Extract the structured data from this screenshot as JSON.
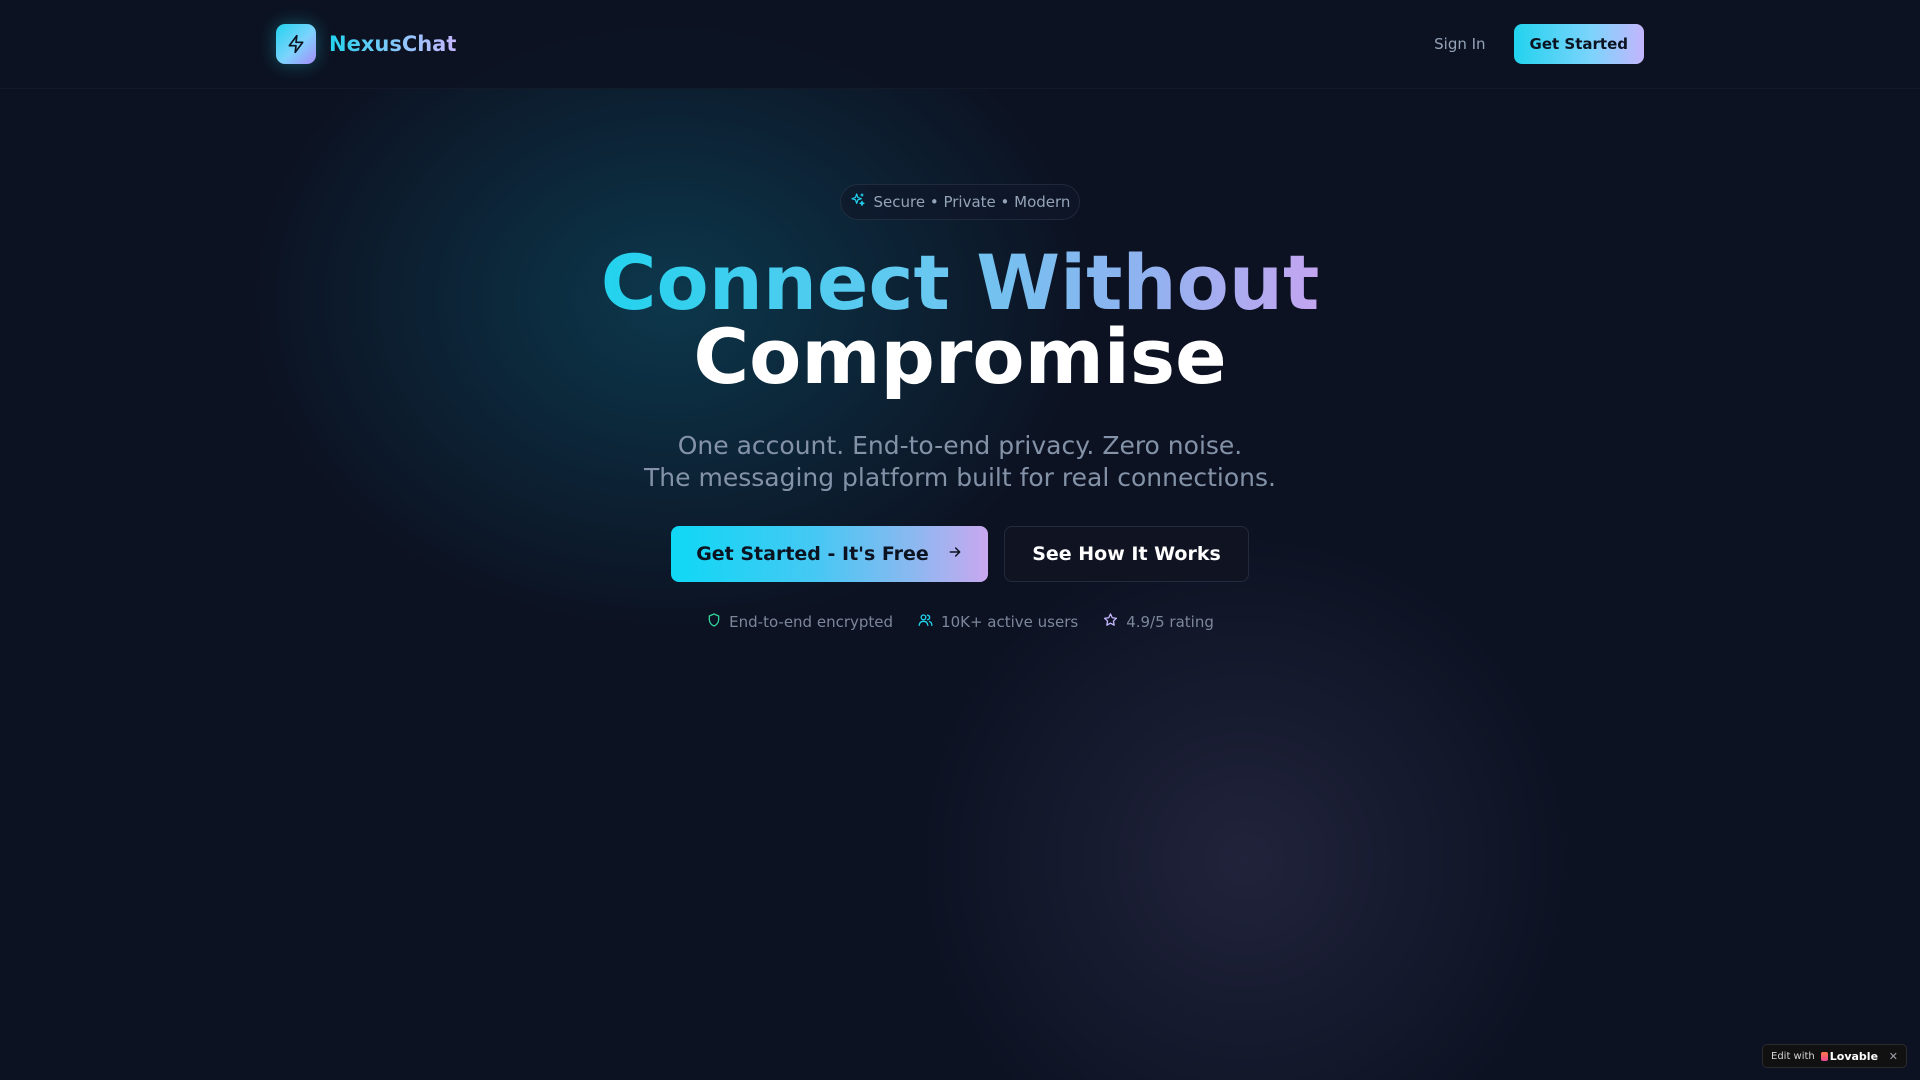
{
  "navbar": {
    "brand_name": "NexusChat",
    "brand_icon": "lightning-bolt-icon",
    "sign_in_label": "Sign In",
    "cta_label": "Get Started"
  },
  "hero": {
    "pill_icon": "sparkles-icon",
    "pill_text": "Secure • Private • Modern",
    "headline_line1": "Connect Without",
    "headline_line2": "Compromise",
    "subtitle_line1": "One account. End-to-end privacy. Zero noise.",
    "subtitle_line2": "The messaging platform built for real connections.",
    "primary_cta_label": "Get Started - It's Free",
    "primary_cta_icon": "arrow-right-icon",
    "secondary_cta_label": "See How It Works",
    "trust_items": [
      {
        "icon": "shield-icon",
        "label": "End-to-end encrypted",
        "color": "#34d399"
      },
      {
        "icon": "users-icon",
        "label": "10K+ active users",
        "color": "#22d3ee"
      },
      {
        "icon": "star-icon",
        "label": "4.9/5 rating",
        "color": "#c4b5fd"
      }
    ]
  },
  "badge": {
    "prefix": "Edit with",
    "brand": "Lovable",
    "close_symbol": "✕"
  },
  "colors": {
    "background": "#0c1222",
    "accent_cyan": "#22d3ee",
    "accent_violet": "#c4b5fd",
    "muted_text": "#8492a8"
  }
}
